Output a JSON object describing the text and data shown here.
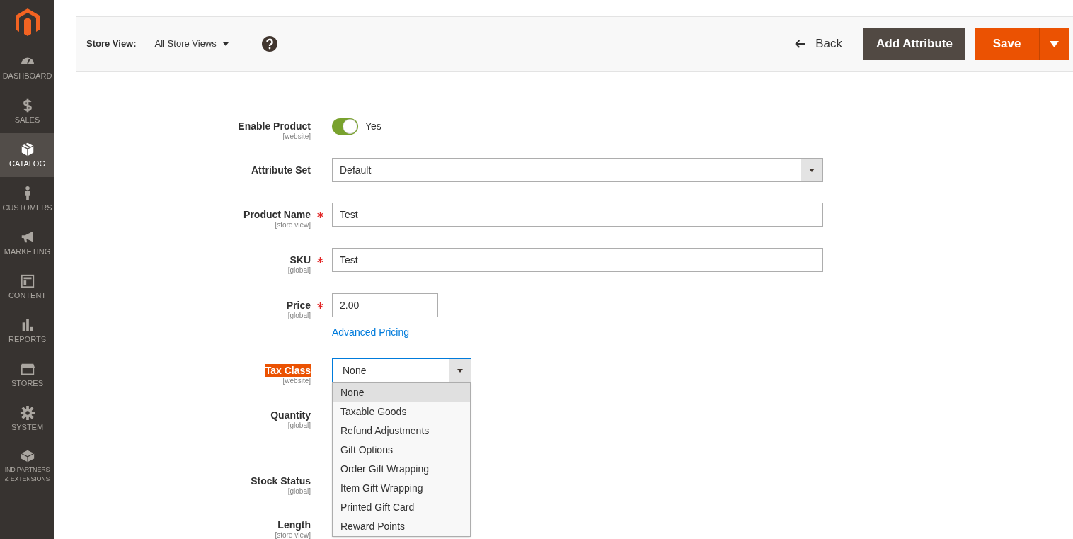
{
  "sidebar": {
    "items": [
      {
        "label": "DASHBOARD",
        "selected": false
      },
      {
        "label": "SALES",
        "selected": false
      },
      {
        "label": "CATALOG",
        "selected": true
      },
      {
        "label": "CUSTOMERS",
        "selected": false
      },
      {
        "label": "MARKETING",
        "selected": false
      },
      {
        "label": "CONTENT",
        "selected": false
      },
      {
        "label": "REPORTS",
        "selected": false
      },
      {
        "label": "STORES",
        "selected": false
      },
      {
        "label": "SYSTEM",
        "selected": false
      },
      {
        "label": "IND PARTNERS\n& EXTENSIONS",
        "selected": false
      }
    ]
  },
  "toolbar": {
    "store_view_label": "Store View:",
    "store_view_value": "All Store Views",
    "back": "Back",
    "add_attribute": "Add Attribute",
    "save": "Save"
  },
  "fields": [
    {
      "kind": "toggle",
      "label": "Enable Product",
      "scope": "[website]",
      "required": false,
      "on": true,
      "value": "Yes"
    },
    {
      "kind": "select",
      "label": "Attribute Set",
      "required": false,
      "value": "Default"
    },
    {
      "kind": "text",
      "label": "Product Name",
      "scope": "[store view]",
      "required": true,
      "value": "Test"
    },
    {
      "kind": "text",
      "label": "SKU",
      "scope": "[global]",
      "required": true,
      "value": "Test"
    },
    {
      "kind": "price",
      "label": "Price",
      "scope": "[global]",
      "required": true,
      "value": "2.00",
      "link": "Advanced Pricing"
    },
    {
      "kind": "dropdown",
      "label": "Tax Class",
      "scope": "[website]",
      "required": false,
      "highlighted": true,
      "value": "None",
      "options": [
        {
          "label": "None",
          "selected": true
        },
        {
          "label": "Taxable Goods",
          "selected": false
        },
        {
          "label": "Refund Adjustments",
          "selected": false
        },
        {
          "label": "Gift Options",
          "selected": false
        },
        {
          "label": "Order Gift Wrapping",
          "selected": false
        },
        {
          "label": "Item Gift Wrapping",
          "selected": false
        },
        {
          "label": "Printed Gift Card",
          "selected": false
        },
        {
          "label": "Reward Points",
          "selected": false
        }
      ]
    },
    {
      "kind": "inventory",
      "label": "Quantity",
      "scope": "[global]",
      "required": false
    },
    {
      "kind": "plain",
      "label": "Stock Status",
      "scope": "[global]",
      "required": false
    },
    {
      "kind": "plain",
      "label": "Length",
      "scope": "[store view]",
      "required": false
    }
  ]
}
